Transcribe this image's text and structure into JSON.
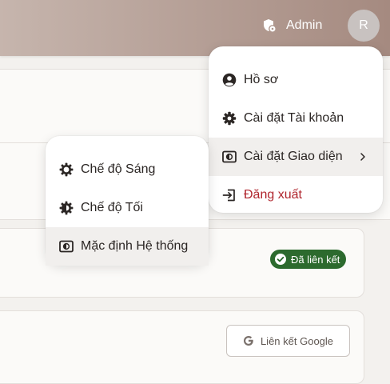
{
  "header": {
    "admin_label": "Admin",
    "avatar_initial": "R"
  },
  "user_menu": {
    "items": [
      {
        "label": "Hồ sơ",
        "icon": "user-circle-icon"
      },
      {
        "label": "Cài đặt Tài khoản",
        "icon": "gear-icon"
      },
      {
        "label": "Cài đặt Giao diện",
        "icon": "display-mode-icon"
      },
      {
        "label": "Đăng xuất",
        "icon": "logout-icon"
      }
    ]
  },
  "theme_menu": {
    "items": [
      {
        "label": "Chế độ Sáng",
        "icon": "sun-icon"
      },
      {
        "label": "Chế độ Tối",
        "icon": "moon-icon"
      },
      {
        "label": "Mặc định Hệ thống",
        "icon": "system-mode-icon",
        "selected": true
      }
    ]
  },
  "content": {
    "linked_badge": "Đã liên kết",
    "google_button": "Liên kết Google"
  },
  "colors": {
    "header_start": "#c6b5ad",
    "header_end": "#a58a80",
    "badge_green": "#2c6a2e",
    "danger_red": "#b0262e"
  }
}
